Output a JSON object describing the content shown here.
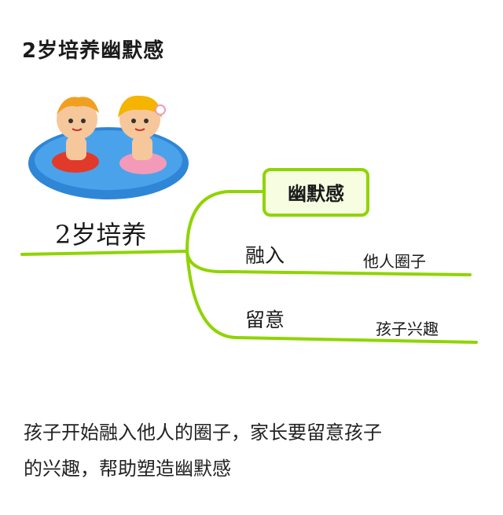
{
  "title": "2岁培养幽默感",
  "mindmap": {
    "root": "2岁培养",
    "highlight_node": "幽默感",
    "branches": [
      {
        "label": "融入",
        "detail": "他人圈子"
      },
      {
        "label": "留意",
        "detail": "孩子兴趣"
      }
    ]
  },
  "caption_lines": [
    "孩子开始融入他人的圈子，家长要留意孩子",
    "的兴趣，帮助塑造幽默感"
  ],
  "colors": {
    "branch": "#8fd400",
    "node_fill": "#f6fde0",
    "pool": "#2f86d6",
    "float": "#e23a2a"
  }
}
